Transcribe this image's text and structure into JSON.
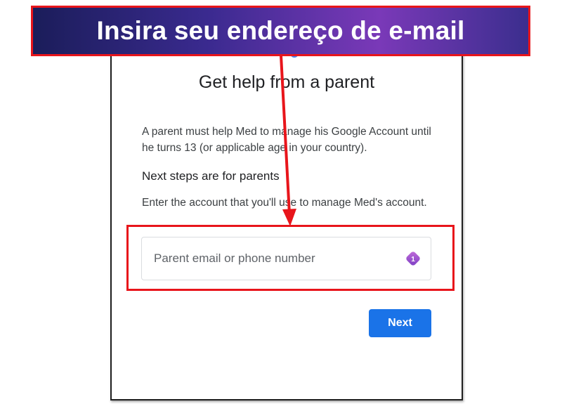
{
  "annotation": {
    "callout_text": "Insira seu endereço de e-mail",
    "color": "#e8151b"
  },
  "dialog": {
    "title": "Get help from a parent",
    "description": "A parent must help Med to manage his Google Account until he turns 13 (or applicable age in your country).",
    "subheading": "Next steps are for parents",
    "instruction": "Enter the account that you'll use to manage Med's account.",
    "email_input": {
      "value": "",
      "placeholder": "Parent email or phone number",
      "extension_icon": "password-manager-icon",
      "extension_badge": "1"
    },
    "next_label": "Next",
    "accent_color": "#1a73e8"
  }
}
